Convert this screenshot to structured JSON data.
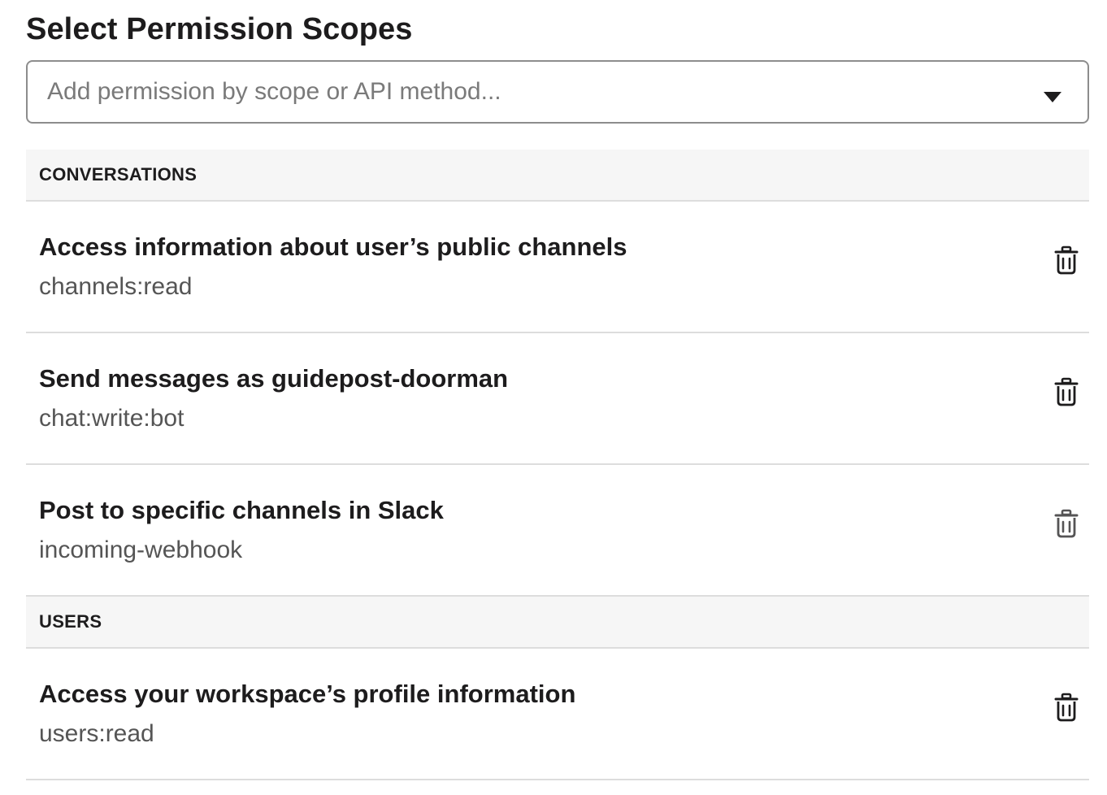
{
  "header": {
    "title": "Select Permission Scopes"
  },
  "scope_picker": {
    "placeholder": "Add permission by scope or API method...",
    "value": "",
    "icon": "chevron-down-icon"
  },
  "sections": [
    {
      "heading": "CONVERSATIONS",
      "scopes": [
        {
          "description": "Access information about user’s public channels",
          "scope": "channels:read",
          "remove_icon": "trash-icon"
        },
        {
          "description": "Send messages as guidepost-doorman",
          "scope": "chat:write:bot",
          "remove_icon": "trash-icon"
        },
        {
          "description": "Post to specific channels in Slack",
          "scope": "incoming-webhook",
          "remove_icon": "trash-icon"
        }
      ]
    },
    {
      "heading": "USERS",
      "scopes": [
        {
          "description": "Access your workspace’s profile information",
          "scope": "users:read",
          "remove_icon": "trash-icon"
        }
      ]
    }
  ],
  "colors": {
    "text": "#1d1c1d",
    "secondary_text": "#555555",
    "section_background": "#f6f6f6",
    "divider": "#dddddd",
    "input_border": "#8d8d8d"
  }
}
